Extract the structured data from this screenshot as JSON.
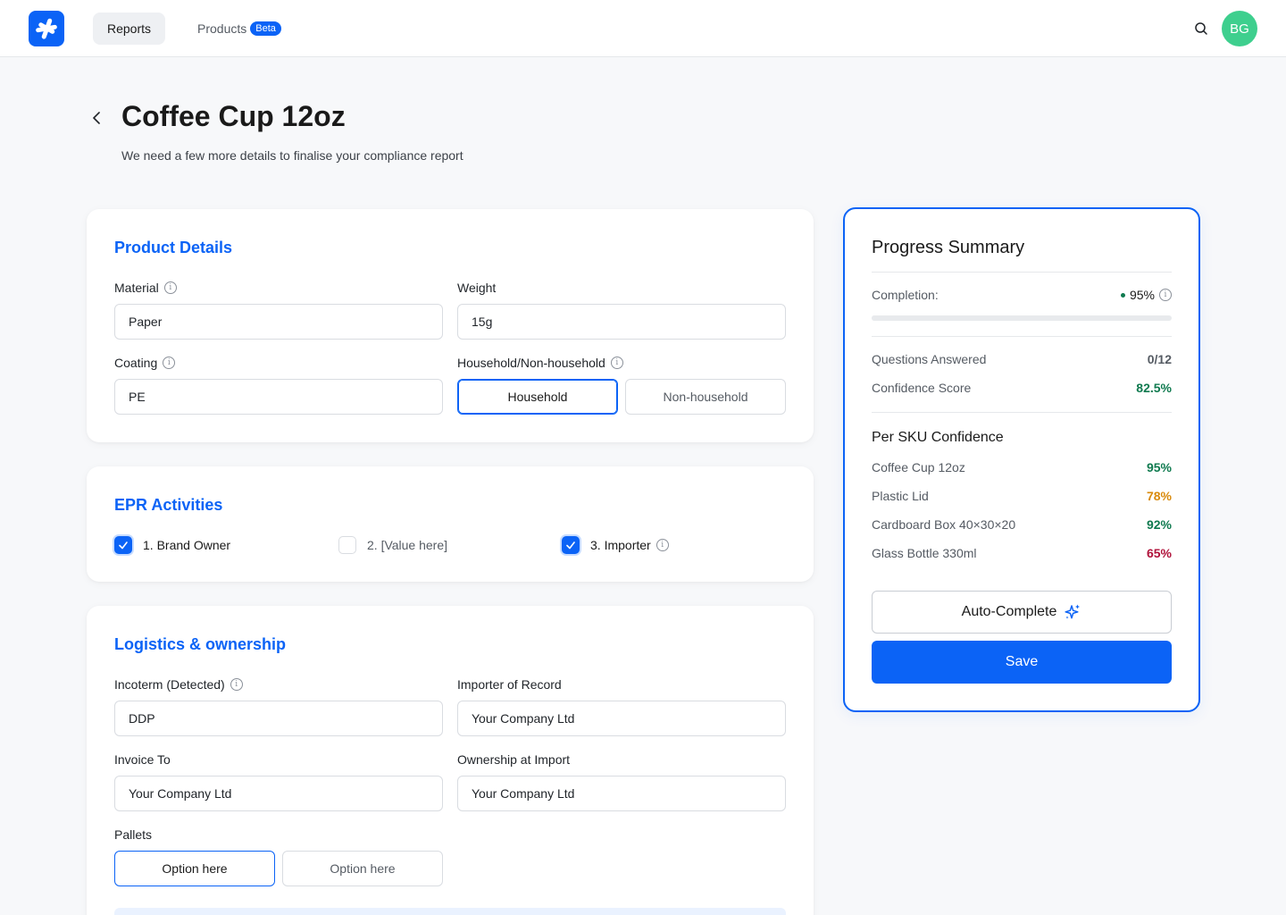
{
  "nav": {
    "reports": "Reports",
    "products": "Products",
    "products_badge": "Beta",
    "avatar_initials": "BG"
  },
  "header": {
    "title": "Coffee Cup 12oz",
    "subtitle": "We need a few more details to finalise your compliance report"
  },
  "product_details": {
    "title": "Product Details",
    "material_label": "Material",
    "material_value": "Paper",
    "weight_label": "Weight",
    "weight_value": "15g",
    "coating_label": "Coating",
    "coating_value": "PE",
    "household_label": "Household/Non-household",
    "household_options": [
      "Household",
      "Non-household"
    ],
    "household_selected": "Household"
  },
  "epr": {
    "title": "EPR Activities",
    "items": [
      {
        "label": "1. Brand Owner",
        "checked": true
      },
      {
        "label": "2. [Value here]",
        "checked": false
      },
      {
        "label": "3. Importer",
        "checked": true
      }
    ]
  },
  "logistics": {
    "title": "Logistics & ownership",
    "incoterm_label": "Incoterm (Detected)",
    "incoterm_value": "DDP",
    "importer_label": "Importer of Record",
    "importer_value": "Your Company Ltd",
    "invoice_label": "Invoice To",
    "invoice_value": "Your Company Ltd",
    "ownership_label": "Ownership at Import",
    "ownership_value": "Your Company Ltd",
    "pallets_label": "Pallets",
    "pallets_options": [
      "Option here",
      "Option here"
    ],
    "pallets_selected_index": 0
  },
  "summary": {
    "title": "Progress Summary",
    "completion_label": "Completion:",
    "completion_value": "95%",
    "completion_fraction": 0.95,
    "questions_label": "Questions Answered",
    "questions_value": "0/12",
    "confidence_label": "Confidence Score",
    "confidence_value": "82.5%",
    "per_sku_title": "Per SKU Confidence",
    "skus": [
      {
        "name": "Coffee Cup 12oz",
        "value": "95%",
        "color": "#0f7a4f"
      },
      {
        "name": "Plastic Lid",
        "value": "78%",
        "color": "#d98a0b"
      },
      {
        "name": "Cardboard Box 40×30×20",
        "value": "92%",
        "color": "#0f7a4f"
      },
      {
        "name": "Glass Bottle 330ml",
        "value": "65%",
        "color": "#b0123a"
      }
    ],
    "autocomplete_label": "Auto-Complete",
    "save_label": "Save"
  },
  "colors": {
    "accent": "#0b63f6",
    "success": "#0f7a4f",
    "avatar": "#3ecf8e"
  }
}
